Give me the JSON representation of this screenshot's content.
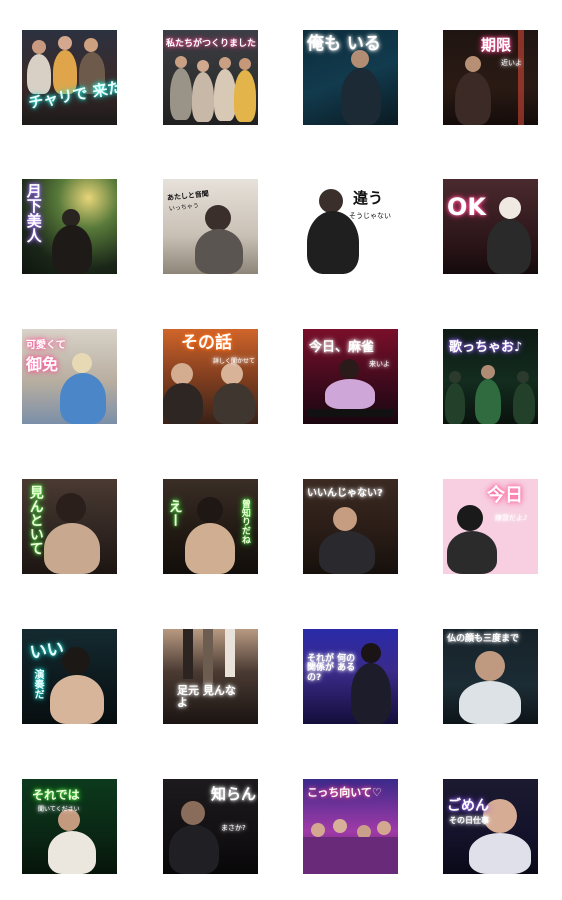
{
  "stickers": [
    {
      "caption": "チャリで 来た",
      "sub": ""
    },
    {
      "caption": "私たちがつくりました",
      "sub": ""
    },
    {
      "caption": "俺も いる",
      "sub": ""
    },
    {
      "caption": "期限",
      "sub": "近いよ"
    },
    {
      "caption": "月下美人",
      "sub": ""
    },
    {
      "caption": "あたしと音聞",
      "sub": "いっちゃう"
    },
    {
      "caption": "違う",
      "sub": "そうじゃない"
    },
    {
      "caption": "OK",
      "sub": ""
    },
    {
      "caption": "可愛くて",
      "sub": "御免"
    },
    {
      "caption": "その話",
      "sub": "詳しく聞かせて"
    },
    {
      "caption": "今日、麻雀",
      "sub": "来いよ"
    },
    {
      "caption": "歌っちゃお♪",
      "sub": ""
    },
    {
      "caption": "見んといて",
      "sub": ""
    },
    {
      "caption": "えー",
      "sub": "曾知りだね"
    },
    {
      "caption": "いいんじゃない?",
      "sub": ""
    },
    {
      "caption": "今日",
      "sub": "練習だよ♪"
    },
    {
      "caption": "いい",
      "sub": "演奏だ"
    },
    {
      "caption": "足元 見んなよ",
      "sub": ""
    },
    {
      "caption": "それが 何の関係が あるの?",
      "sub": ""
    },
    {
      "caption": "仏の顔も三度まで",
      "sub": ""
    },
    {
      "caption": "それでは",
      "sub": "聞いてください"
    },
    {
      "caption": "知らん",
      "sub": "まさか?"
    },
    {
      "caption": "こっち向いて♡",
      "sub": ""
    },
    {
      "caption": "ごめん",
      "sub": "その日仕事"
    }
  ]
}
